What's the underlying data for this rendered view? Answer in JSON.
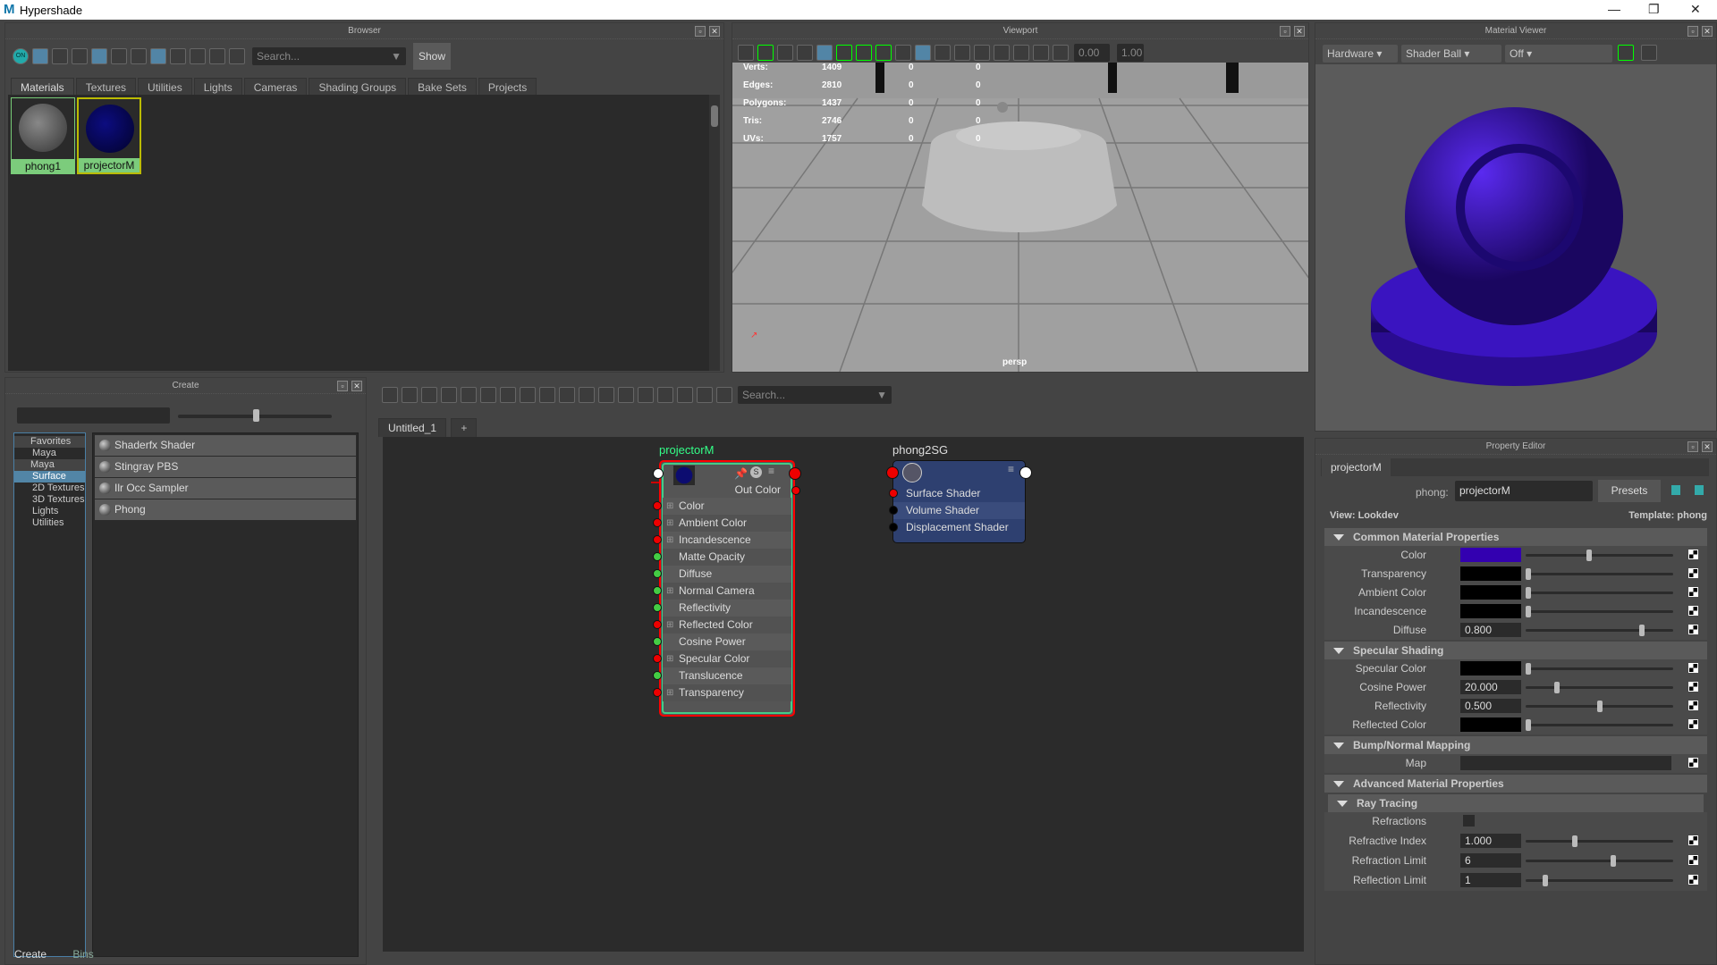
{
  "window": {
    "title": "Hypershade",
    "logo": "M",
    "controls": [
      "—",
      "❐",
      "✕"
    ]
  },
  "browser": {
    "title": "Browser",
    "search_placeholder": "Search...",
    "show_label": "Show",
    "on_label": "ON",
    "tabs": [
      "Materials",
      "Textures",
      "Utilities",
      "Lights",
      "Cameras",
      "Shading Groups",
      "Bake Sets",
      "Projects"
    ],
    "materials": [
      {
        "name": "phong1",
        "color": "#777777"
      },
      {
        "name": "projectorM",
        "color": "#0c0c6a"
      }
    ]
  },
  "viewport": {
    "title": "Viewport",
    "field1": "0.00",
    "field2": "1.00",
    "camera": "persp",
    "stats": [
      {
        "label": "Verts:",
        "values": [
          "1409",
          "0",
          "0"
        ]
      },
      {
        "label": "Edges:",
        "values": [
          "2810",
          "0",
          "0"
        ]
      },
      {
        "label": "Polygons:",
        "values": [
          "1437",
          "0",
          "0"
        ]
      },
      {
        "label": "Tris:",
        "values": [
          "2746",
          "0",
          "0"
        ]
      },
      {
        "label": "UVs:",
        "values": [
          "1757",
          "0",
          "0"
        ]
      }
    ]
  },
  "material_viewer": {
    "title": "Material Viewer",
    "renderer": "Hardware",
    "geometry": "Shader Ball",
    "env": "Off",
    "shader_color": "#3a10d0"
  },
  "create": {
    "title": "Create",
    "tree": [
      {
        "label": "Favorites",
        "type": "header"
      },
      {
        "label": "Maya",
        "type": "sub"
      },
      {
        "label": "Maya",
        "type": "header"
      },
      {
        "label": "Surface",
        "type": "selected"
      },
      {
        "label": "2D Textures"
      },
      {
        "label": "3D Textures"
      },
      {
        "label": "Lights"
      },
      {
        "label": "Utilities"
      }
    ],
    "items": [
      "Shaderfx Shader",
      "Stingray PBS",
      "Ilr Occ Sampler",
      "Phong"
    ],
    "bottom_tabs": [
      "Create",
      "Bins"
    ]
  },
  "node_editor": {
    "search_placeholder": "Search...",
    "tabs": [
      "Untitled_1",
      "+"
    ],
    "node1": {
      "name": "projectorM",
      "out": "Out Color",
      "attrs": [
        {
          "label": "Color",
          "port": "red",
          "exp": true
        },
        {
          "label": "Ambient Color",
          "port": "red",
          "exp": true
        },
        {
          "label": "Incandescence",
          "port": "red",
          "exp": true
        },
        {
          "label": "Matte Opacity",
          "port": "green"
        },
        {
          "label": "Diffuse",
          "port": "green"
        },
        {
          "label": "Normal Camera",
          "port": "green",
          "exp": true
        },
        {
          "label": "Reflectivity",
          "port": "green"
        },
        {
          "label": "Reflected Color",
          "port": "red",
          "exp": true
        },
        {
          "label": "Cosine Power",
          "port": "green"
        },
        {
          "label": "Specular Color",
          "port": "red",
          "exp": true
        },
        {
          "label": "Translucence",
          "port": "green"
        },
        {
          "label": "Transparency",
          "port": "red",
          "exp": true
        }
      ]
    },
    "node2": {
      "name": "phong2SG",
      "attrs": [
        {
          "label": "Surface Shader",
          "port": "red"
        },
        {
          "label": "Volume Shader",
          "port": "black"
        },
        {
          "label": "Displacement Shader",
          "port": "black"
        }
      ]
    }
  },
  "property_editor": {
    "title": "Property Editor",
    "tab": "projectorM",
    "type_label": "phong:",
    "name_value": "projectorM",
    "presets": "Presets",
    "view": "View: Lookdev",
    "template": "Template: phong",
    "sections": [
      {
        "title": "Common Material Properties",
        "rows": [
          {
            "label": "Color",
            "swatch": "#3300b0",
            "slider": 0.43
          },
          {
            "label": "Transparency",
            "swatch": "#000000",
            "slider": 0
          },
          {
            "label": "Ambient Color",
            "swatch": "#000000",
            "slider": 0
          },
          {
            "label": "Incandescence",
            "swatch": "#000000",
            "slider": 0
          },
          {
            "label": "Diffuse",
            "value": "0.800",
            "slider": 0.8
          }
        ]
      },
      {
        "title": "Specular Shading",
        "rows": [
          {
            "label": "Specular Color",
            "swatch": "#000000",
            "slider": 0
          },
          {
            "label": "Cosine Power",
            "value": "20.000",
            "slider": 0.2
          },
          {
            "label": "Reflectivity",
            "value": "0.500",
            "slider": 0.5
          },
          {
            "label": "Reflected Color",
            "swatch": "#000000",
            "slider": 0
          }
        ]
      },
      {
        "title": "Bump/Normal Mapping",
        "rows": [
          {
            "label": "Map",
            "map": true
          }
        ]
      },
      {
        "title": "Advanced Material Properties",
        "rows": []
      },
      {
        "title": "Ray Tracing",
        "sub": true,
        "rows": [
          {
            "label": "Refractions",
            "checkbox": false
          },
          {
            "label": "Refractive Index",
            "value": "1.000",
            "slider": 0.33
          },
          {
            "label": "Refraction Limit",
            "value": "6",
            "slider": 0.6
          },
          {
            "label": "Reflection Limit",
            "value": "1",
            "slider": 0.12
          }
        ]
      }
    ]
  }
}
